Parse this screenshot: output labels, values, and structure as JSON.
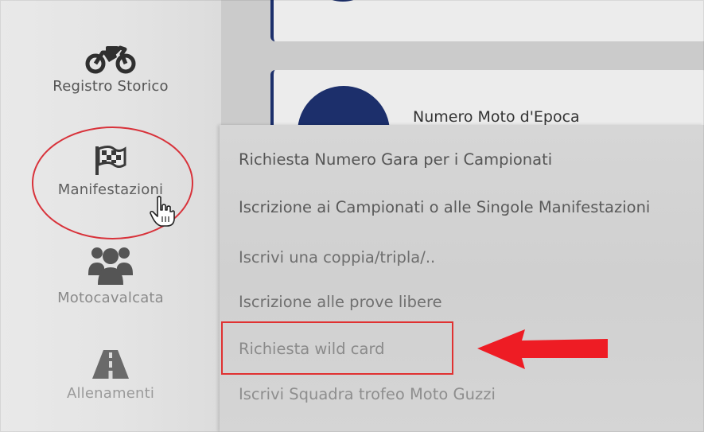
{
  "sidebar": {
    "items": [
      {
        "label": "Registro Storico",
        "icon": "motorcycle-icon"
      },
      {
        "label": "Manifestazioni",
        "icon": "checkered-flag-icon"
      },
      {
        "label": "Motocavalcata",
        "icon": "group-icon"
      },
      {
        "label": "Allenamenti",
        "icon": "road-icon"
      }
    ]
  },
  "content": {
    "cards": [
      {
        "title": ""
      },
      {
        "title": "Numero Moto d'Epoca"
      }
    ]
  },
  "dropdown": {
    "items": [
      {
        "label": "Richiesta Numero Gara per i Campionati"
      },
      {
        "label": "Iscrizione ai Campionati o alle Singole Manifestazioni"
      },
      {
        "label": "Iscrivi una coppia/tripla/.."
      },
      {
        "label": "Iscrizione alle prove libere"
      },
      {
        "label": "Richiesta wild card"
      },
      {
        "label": "Iscrivi Squadra trofeo Moto Guzzi"
      }
    ]
  },
  "annotations": {
    "oval_color": "#d8323a",
    "box_color": "#e03131",
    "arrow_color": "#ee1c24"
  },
  "colors": {
    "card_accent": "#1c2f6b"
  }
}
